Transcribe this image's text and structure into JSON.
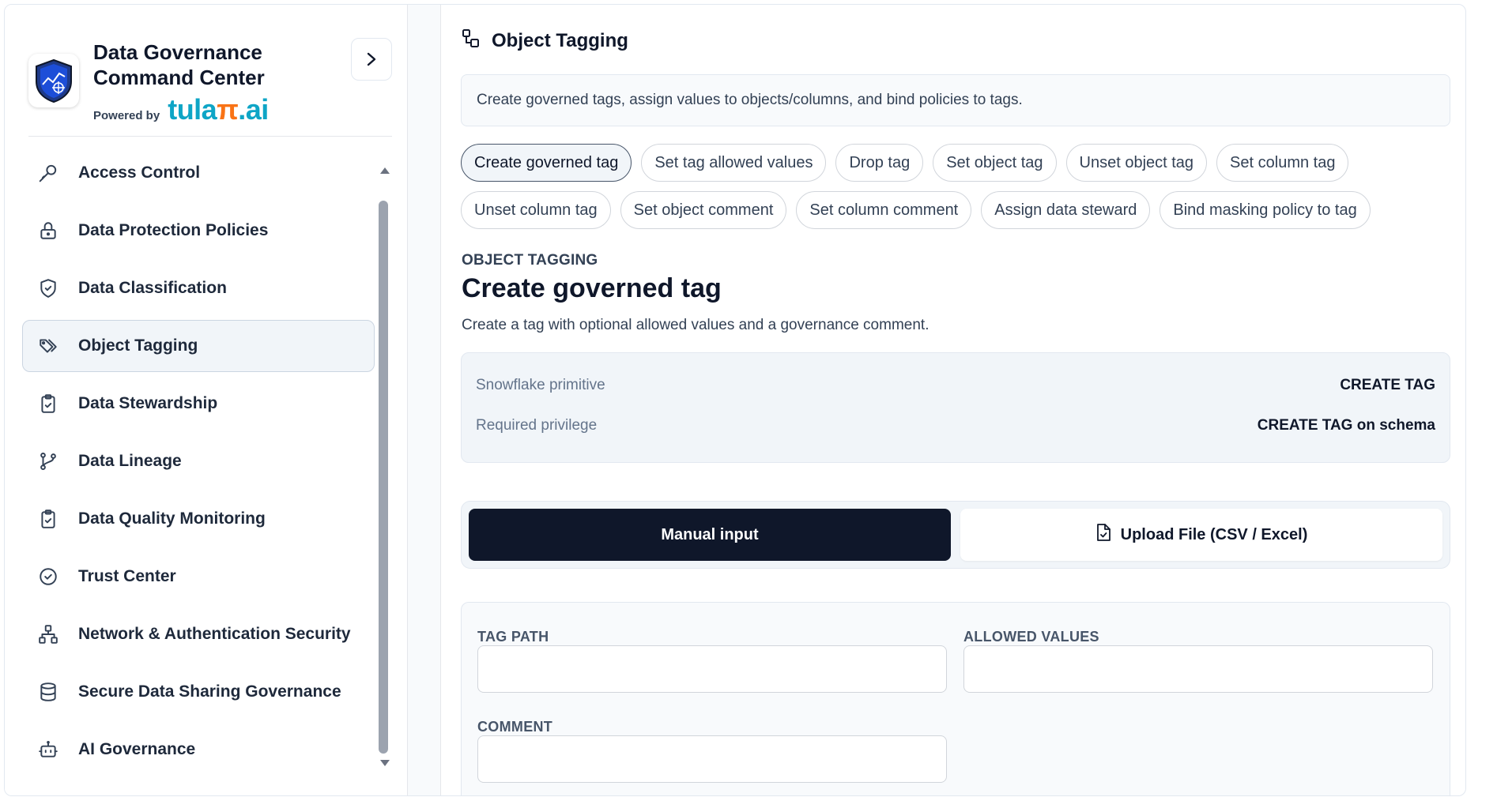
{
  "sidebar": {
    "brand_title_line1": "Data Governance",
    "brand_title_line2": "Command Center",
    "powered_label": "Powered by",
    "powered_brand_a": "tula",
    "powered_brand_pi": "π",
    "powered_brand_b": ".ai",
    "items": [
      {
        "label": "Access Control",
        "icon": "key-icon"
      },
      {
        "label": "Data Protection Policies",
        "icon": "lock-icon"
      },
      {
        "label": "Data Classification",
        "icon": "shield-check-icon"
      },
      {
        "label": "Object Tagging",
        "icon": "tags-icon",
        "active": true
      },
      {
        "label": "Data Stewardship",
        "icon": "clipboard-check-icon"
      },
      {
        "label": "Data Lineage",
        "icon": "git-branch-icon"
      },
      {
        "label": "Data Quality Monitoring",
        "icon": "clipboard-check-icon"
      },
      {
        "label": "Trust Center",
        "icon": "check-circle-icon"
      },
      {
        "label": "Network & Authentication Security",
        "icon": "network-icon"
      },
      {
        "label": "Secure Data Sharing Governance",
        "icon": "database-icon"
      },
      {
        "label": "AI Governance",
        "icon": "bot-icon"
      }
    ]
  },
  "main": {
    "section_title": "Object Tagging",
    "description": "Create governed tags, assign values to objects/columns, and bind policies to tags.",
    "chips_row1": [
      "Create governed tag",
      "Set tag allowed values",
      "Drop tag",
      "Set object tag",
      "Unset object tag",
      "Set column tag"
    ],
    "chips_row2": [
      "Unset column tag",
      "Set object comment",
      "Set column comment",
      "Assign data steward",
      "Bind masking policy to tag"
    ],
    "active_chip": "Create governed tag",
    "eyebrow": "OBJECT TAGGING",
    "heading": "Create governed tag",
    "subtitle": "Create a tag with optional allowed values and a governance comment.",
    "info": {
      "primitive_label": "Snowflake primitive",
      "primitive_value": "CREATE TAG",
      "privilege_label": "Required privilege",
      "privilege_value": "CREATE TAG on schema"
    },
    "tabs": {
      "manual": "Manual input",
      "upload": "Upload File (CSV / Excel)"
    },
    "form": {
      "tag_path_label": "TAG PATH",
      "tag_path_value": "",
      "allowed_values_label": "ALLOWED VALUES",
      "allowed_values_value": "",
      "comment_label": "COMMENT",
      "comment_value": ""
    }
  },
  "colors": {
    "accent_dark": "#0f172a",
    "brand_teal": "#0ea5c6",
    "brand_orange": "#f97316"
  }
}
